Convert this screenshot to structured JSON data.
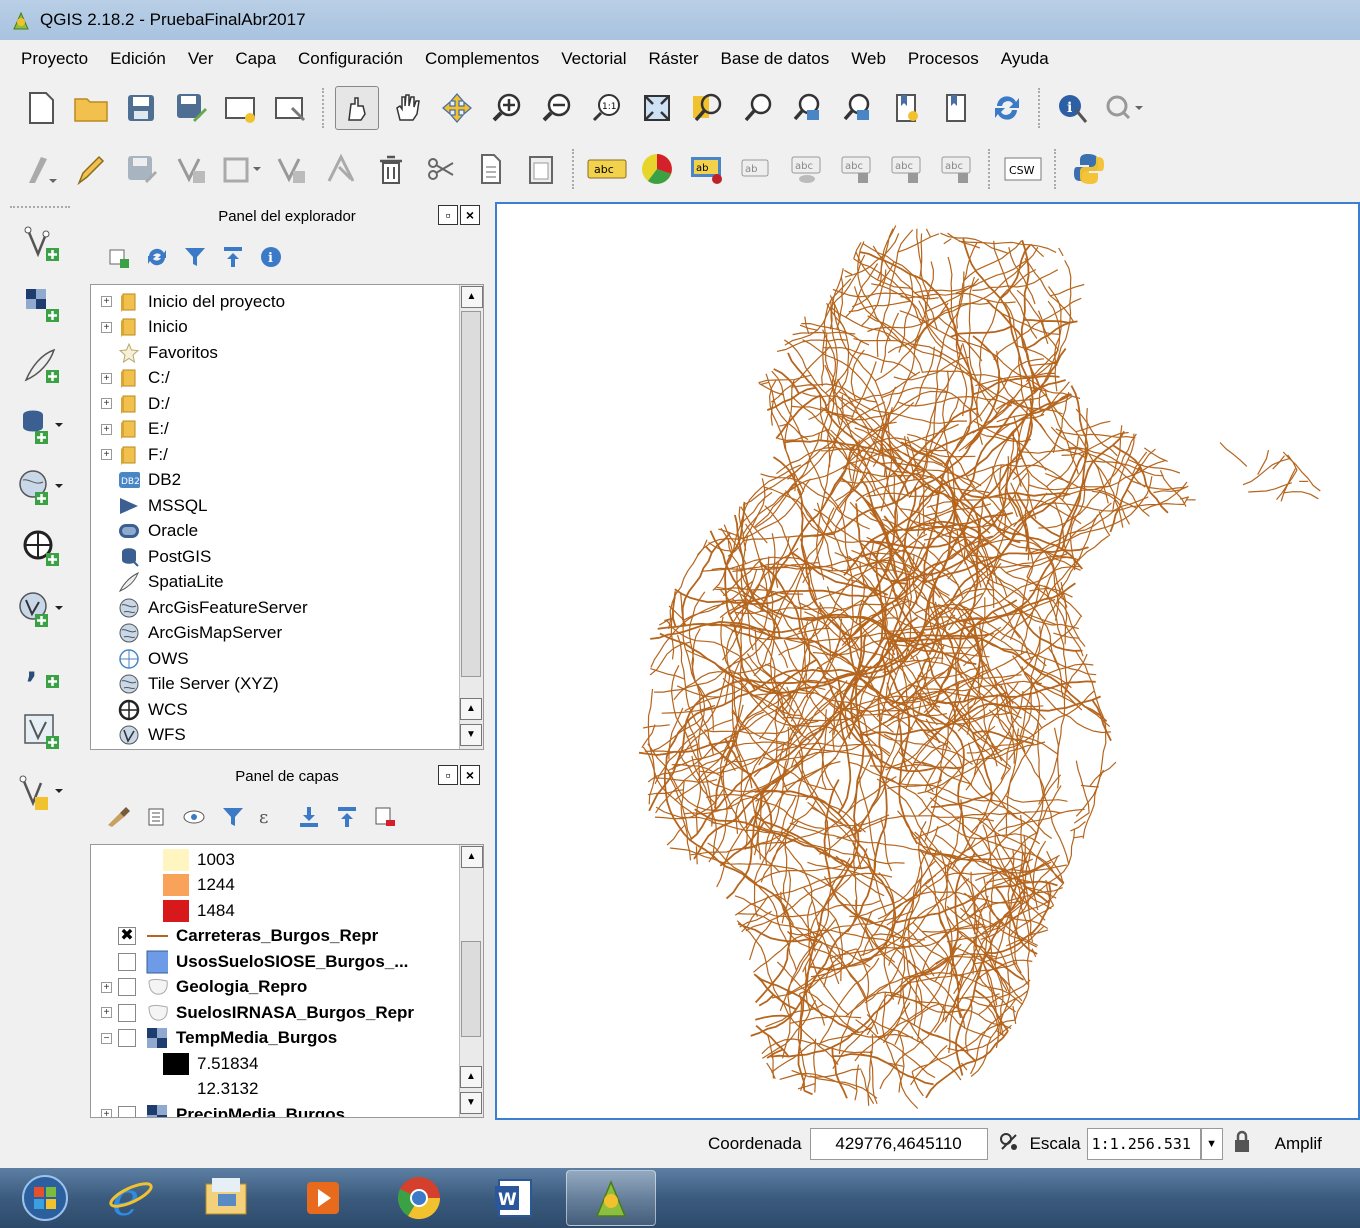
{
  "window": {
    "title": "QGIS 2.18.2 - PruebaFinalAbr2017"
  },
  "menu": [
    "Proyecto",
    "Edición",
    "Ver",
    "Capa",
    "Configuración",
    "Complementos",
    "Vectorial",
    "Ráster",
    "Base de datos",
    "Web",
    "Procesos",
    "Ayuda"
  ],
  "toolbar_icons": {
    "row1": [
      "new-project",
      "open-project",
      "save-project",
      "save-as",
      "new-print-composer",
      "composer-manager",
      "select-pan-touch",
      "pan",
      "pan-to-selection",
      "zoom-in",
      "zoom-out",
      "zoom-native",
      "zoom-full",
      "zoom-to-selection",
      "zoom-to-layer",
      "zoom-last",
      "zoom-next",
      "new-bookmark",
      "show-bookmarks",
      "refresh",
      "identify",
      "measure"
    ],
    "row2": [
      "current-edits",
      "toggle-editing",
      "save-edits",
      "add-feature",
      "move-feature",
      "node-tool",
      "delete-selected",
      "cut",
      "copy",
      "paste",
      "label",
      "diagram",
      "layer-labeling",
      "pin-labels",
      "show-hide-labels",
      "move-label",
      "rotate-label",
      "change-label",
      "metasearch-csw",
      "python-console"
    ]
  },
  "sidebar_icons": [
    "add-vector",
    "add-raster",
    "add-spatialite",
    "add-postgis",
    "add-wms",
    "add-wcs",
    "add-wfs",
    "add-delimited-text",
    "add-virtual-layer",
    "new-shapefile"
  ],
  "browser_panel": {
    "title": "Panel del explorador",
    "items": [
      {
        "label": "Inicio del proyecto",
        "icon": "folder",
        "expandable": true
      },
      {
        "label": "Inicio",
        "icon": "folder",
        "expandable": true
      },
      {
        "label": "Favoritos",
        "icon": "star",
        "expandable": false
      },
      {
        "label": "C:/",
        "icon": "folder",
        "expandable": true
      },
      {
        "label": "D:/",
        "icon": "folder",
        "expandable": true
      },
      {
        "label": "E:/",
        "icon": "folder",
        "expandable": true
      },
      {
        "label": "F:/",
        "icon": "folder",
        "expandable": true
      },
      {
        "label": "DB2",
        "icon": "db2",
        "expandable": false
      },
      {
        "label": "MSSQL",
        "icon": "mssql",
        "expandable": false
      },
      {
        "label": "Oracle",
        "icon": "oracle",
        "expandable": false
      },
      {
        "label": "PostGIS",
        "icon": "postgis",
        "expandable": false
      },
      {
        "label": "SpatiaLite",
        "icon": "spatialite",
        "expandable": false
      },
      {
        "label": "ArcGisFeatureServer",
        "icon": "globe",
        "expandable": false
      },
      {
        "label": "ArcGisMapServer",
        "icon": "globe",
        "expandable": false
      },
      {
        "label": "OWS",
        "icon": "globe-blue",
        "expandable": false
      },
      {
        "label": "Tile Server (XYZ)",
        "icon": "globe",
        "expandable": false
      },
      {
        "label": "WCS",
        "icon": "globe-dark",
        "expandable": false
      },
      {
        "label": "WFS",
        "icon": "wfs",
        "expandable": false
      }
    ]
  },
  "layers_panel": {
    "title": "Panel de capas",
    "items": [
      {
        "type": "legend",
        "label": "1003",
        "color": "#fff5c0"
      },
      {
        "type": "legend",
        "label": "1244",
        "color": "#f9a35a"
      },
      {
        "type": "legend",
        "label": "1484",
        "color": "#d7191c"
      },
      {
        "type": "layer",
        "label": "Carreteras_Burgos_Repr",
        "checked": true,
        "symbol": "line",
        "color": "#b5651d",
        "expandable": false
      },
      {
        "type": "layer",
        "label": "UsosSueloSIOSE_Burgos_...",
        "checked": false,
        "symbol": "fill",
        "color": "#6e9be8",
        "expandable": false
      },
      {
        "type": "layer",
        "label": "Geologia_Repro",
        "checked": false,
        "symbol": "polygon-outline",
        "expandable": true
      },
      {
        "type": "layer",
        "label": "SuelosIRNASA_Burgos_Repr",
        "checked": false,
        "symbol": "polygon-outline",
        "expandable": true
      },
      {
        "type": "layer",
        "label": "TempMedia_Burgos",
        "checked": false,
        "symbol": "raster",
        "expandable": true,
        "expanded": true
      },
      {
        "type": "legend",
        "label": "7.51834",
        "color": "#000000"
      },
      {
        "type": "legend",
        "label": "12.3132",
        "color": "#ffffff"
      },
      {
        "type": "layer",
        "label": "PrecipMedia_Burgos",
        "checked": false,
        "symbol": "raster",
        "expandable": true,
        "partial": true
      }
    ]
  },
  "statusbar": {
    "coord_label": "Coordenada",
    "coord_value": "429776,4645110",
    "scale_label": "Escala",
    "scale_value": "1:1.256.531",
    "magnifier_label": "Amplif"
  },
  "map": {
    "layer": "Carreteras_Burgos_Repr",
    "line_color": "#b5651d",
    "background": "#ffffff"
  },
  "taskbar": [
    "start-orb",
    "internet-explorer",
    "file-explorer",
    "media-player",
    "chrome",
    "word",
    "qgis"
  ]
}
